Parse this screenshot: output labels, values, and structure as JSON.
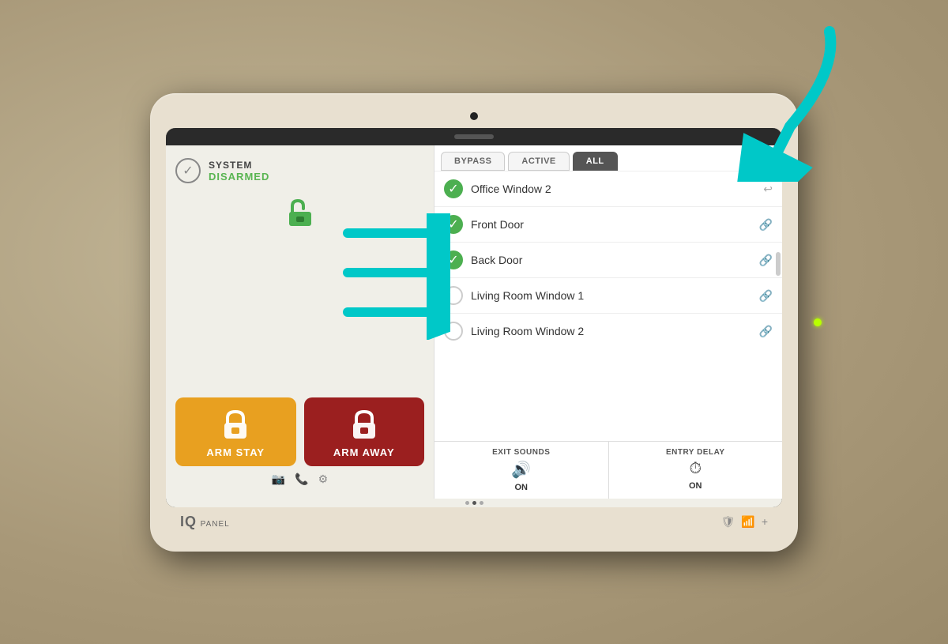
{
  "device": {
    "brand": "IQ",
    "brand_suffix": "PANEL"
  },
  "system": {
    "label": "SYSTEM",
    "state": "DISARMED"
  },
  "filter_tabs": [
    {
      "id": "bypass",
      "label": "BYPASS",
      "active": false
    },
    {
      "id": "active",
      "label": "ACTIVE",
      "active": false
    },
    {
      "id": "all",
      "label": "ALL",
      "active": true
    }
  ],
  "sensors": [
    {
      "name": "Office Window 2",
      "checked": true
    },
    {
      "name": "Front Door",
      "checked": true
    },
    {
      "name": "Back Door",
      "checked": true
    },
    {
      "name": "Living Room Window 1",
      "checked": false
    },
    {
      "name": "Living Room Window 2",
      "checked": false
    }
  ],
  "arm_buttons": {
    "stay_label": "ARM STAY",
    "away_label": "ARM AWAY"
  },
  "exit_sounds": {
    "label": "EXIT SOUNDS",
    "value": "ON"
  },
  "entry_delay": {
    "label": "ENTRY DELAY",
    "value": "ON"
  }
}
